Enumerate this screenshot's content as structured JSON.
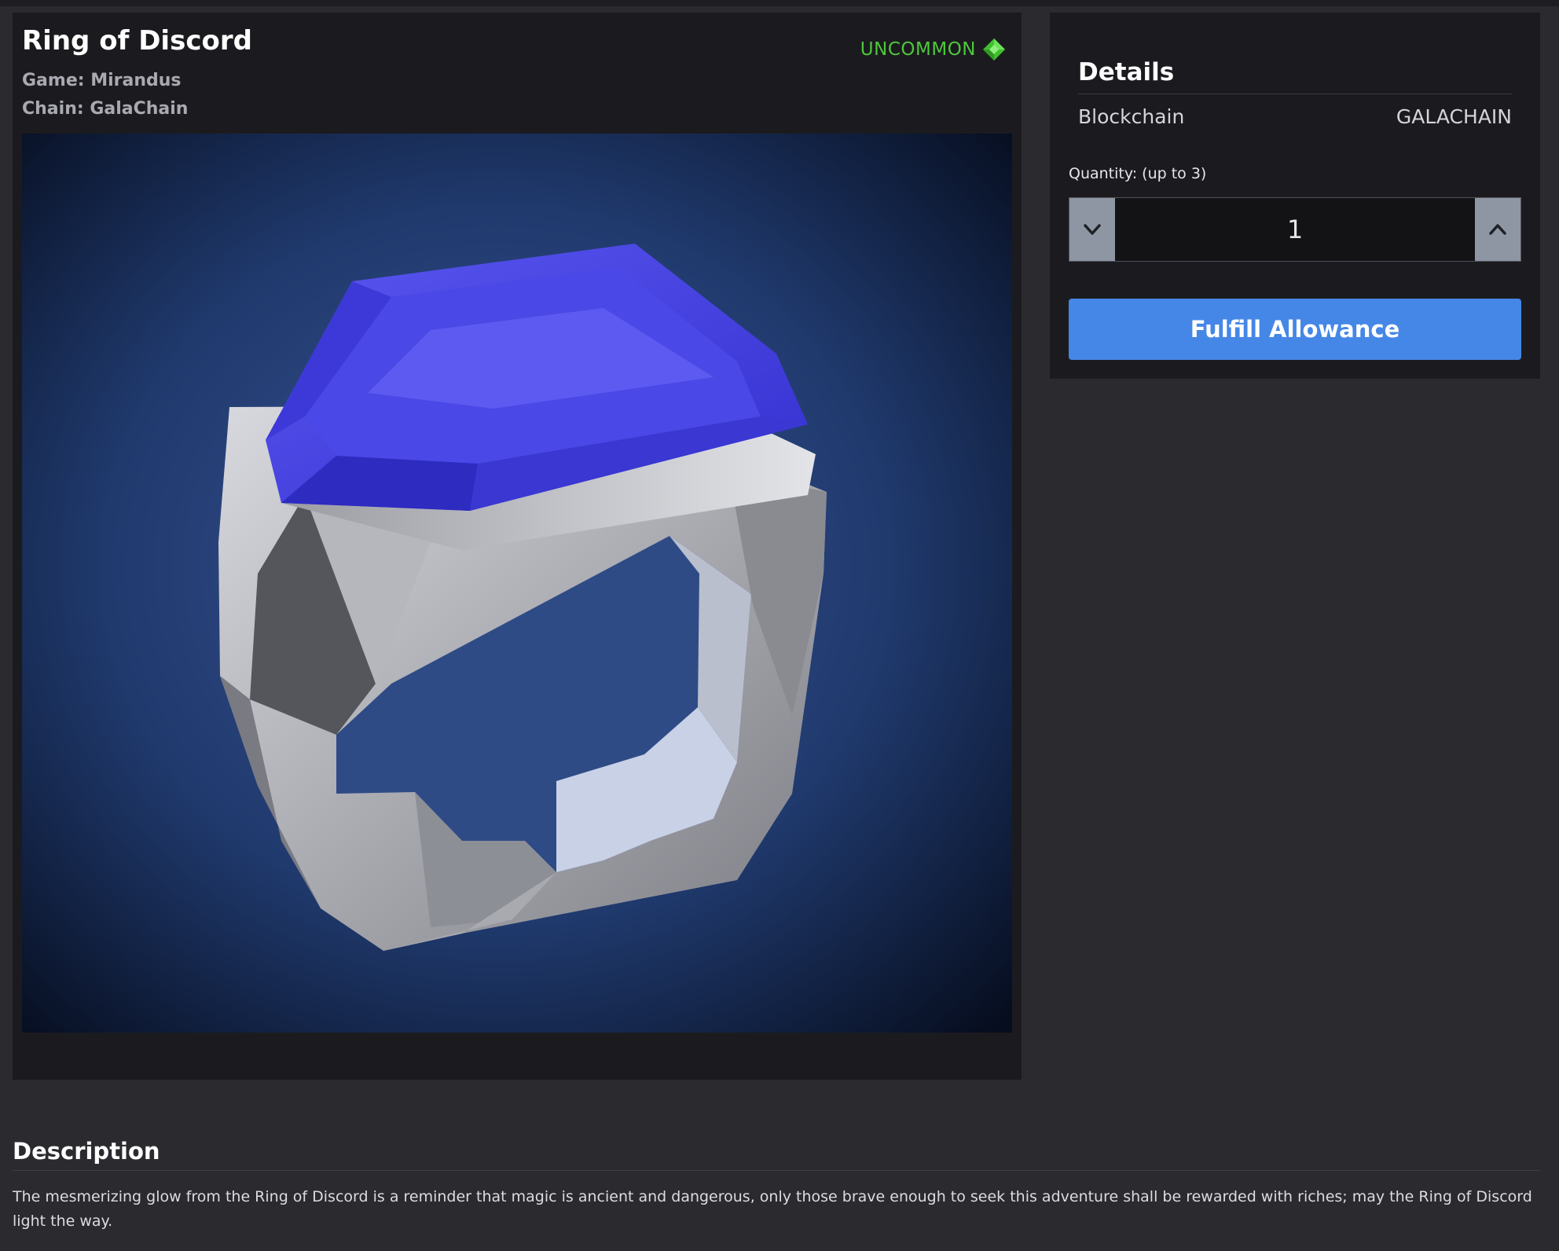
{
  "item": {
    "title": "Ring of Discord",
    "game_line": "Game: Mirandus",
    "chain_line": "Chain: GalaChain",
    "rarity": "UNCOMMON",
    "rarity_color": "#4fc73d",
    "rarity_icon": "diamond-gem-icon"
  },
  "details": {
    "title": "Details",
    "rows": [
      {
        "label": "Blockchain",
        "value": "GALACHAIN"
      }
    ],
    "quantity_label": "Quantity: (up to 3)",
    "quantity_value": "1",
    "decrement_icon": "chevron-down-icon",
    "increment_icon": "chevron-up-icon",
    "action_button": "Fulfill Allowance",
    "action_color": "#4587e6"
  },
  "description": {
    "title": "Description",
    "text": "The mesmerizing glow from the Ring of Discord is a reminder that magic is ancient and dangerous, only those brave enough to seek this adventure shall be rewarded with riches; may the Ring of Discord light the way."
  }
}
